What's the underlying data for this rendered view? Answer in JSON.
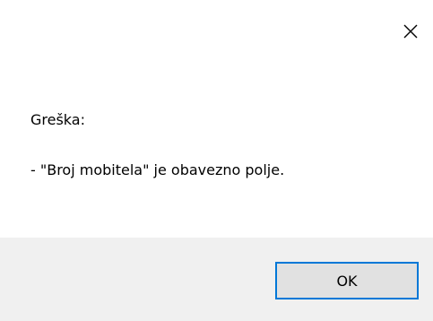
{
  "dialog": {
    "close_icon": "close-icon",
    "error_title": "Greška:",
    "error_message": " - \"Broj mobitela\" je obavezno polje.",
    "ok_label": "OK",
    "colors": {
      "background": "#ffffff",
      "footer": "#f0f0f0",
      "button": "#e1e1e1",
      "button_border": "#0078d7"
    }
  }
}
